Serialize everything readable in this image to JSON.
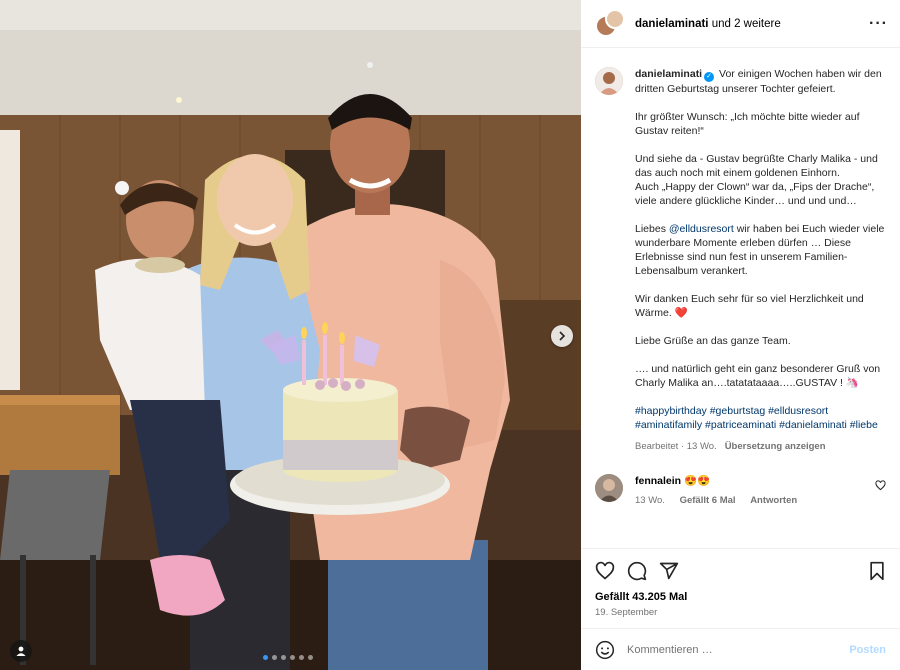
{
  "post": {
    "carousel": {
      "dot_count": 6,
      "active_index": 0
    },
    "header": {
      "username": "danielaminati",
      "others": "und 2 weitere"
    },
    "caption": {
      "username": "danielaminati",
      "p1": " Vor einigen Wochen haben wir den dritten Geburtstag unserer Tochter gefeiert.",
      "p2": "Ihr größter Wunsch: „Ich möchte bitte wieder auf Gustav reiten!“",
      "p3": "Und siehe da - Gustav begrüßte Charly Malika - und das auch noch mit einem goldenen Einhorn.",
      "p3b": "Auch „Happy der Clown“ war da, „Fips der Drache“, viele andere glückliche Kinder… und und und…",
      "p4_a": "Liebes ",
      "p4_link": "@elldusresort",
      "p4_b": " wir haben bei Euch wieder viele wunderbare Momente erleben dürfen … Diese Erlebnisse sind nun fest in unserem Familien-Lebensalbum verankert.",
      "p5": "Wir danken Euch sehr für so viel Herzlichkeit und Wärme. ❤️",
      "p6": "Liebe Grüße an das ganze Team.",
      "p7": "…. und natürlich geht ein ganz besonderer Gruß von Charly Malika an….tatatataaaa…..GUSTAV ! 🦄",
      "hashtags": "#happybirthday #geburtstag #elldusresort #aminatifamily #patriceaminati #danielaminati #liebe",
      "edited": "Bearbeitet · 13 Wo.",
      "translate": "Übersetzung anzeigen"
    },
    "comment": {
      "username": "fennalein",
      "text": " 😍😍",
      "age": "13 Wo.",
      "likes": "Gefällt 6 Mal",
      "reply": "Antworten"
    },
    "likes": "Gefällt 43.205 Mal",
    "date": "19. September",
    "comment_box": {
      "placeholder": "Kommentieren …",
      "post_label": "Posten"
    }
  },
  "colors": {
    "accent": "#0095f6",
    "heart": "#ed4956",
    "link": "#00376b"
  },
  "icons": [
    "heart-icon",
    "comment-icon",
    "share-icon",
    "bookmark-icon",
    "emoji-icon",
    "more-icon",
    "chevron-right-icon",
    "user-tag-icon"
  ]
}
